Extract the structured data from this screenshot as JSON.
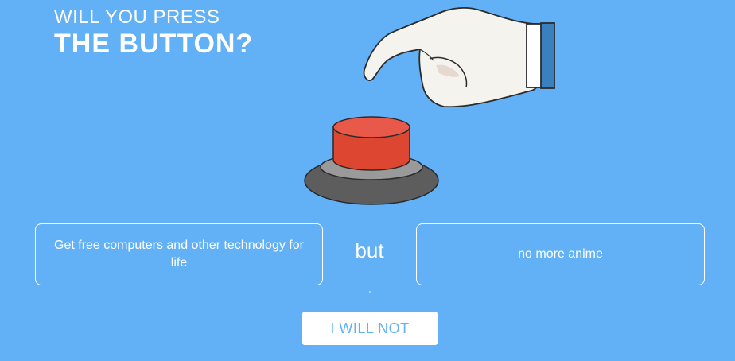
{
  "logo": {
    "line1": "WILL YOU PRESS",
    "line2": "THE BUTTON?"
  },
  "illustration": {
    "hand_icon": "hand-pointing-icon",
    "button_icon": "red-button-icon",
    "colors": {
      "button_top": "#e8594a",
      "button_body": "#dd4630",
      "base_light": "#9a9a9a",
      "base_dark": "#5d5d5d",
      "hand": "#f5f3ee",
      "cuff": "#ffffff",
      "sleeve": "#3a7fbe"
    }
  },
  "dilemma": {
    "good": "Get free computers and other technology for life",
    "connector": "but",
    "bad": "no more anime"
  },
  "action": {
    "decline_label": "I WILL NOT"
  },
  "colors": {
    "background": "#62b1f6",
    "text": "#ffffff",
    "button_text": "#62b1f6"
  }
}
